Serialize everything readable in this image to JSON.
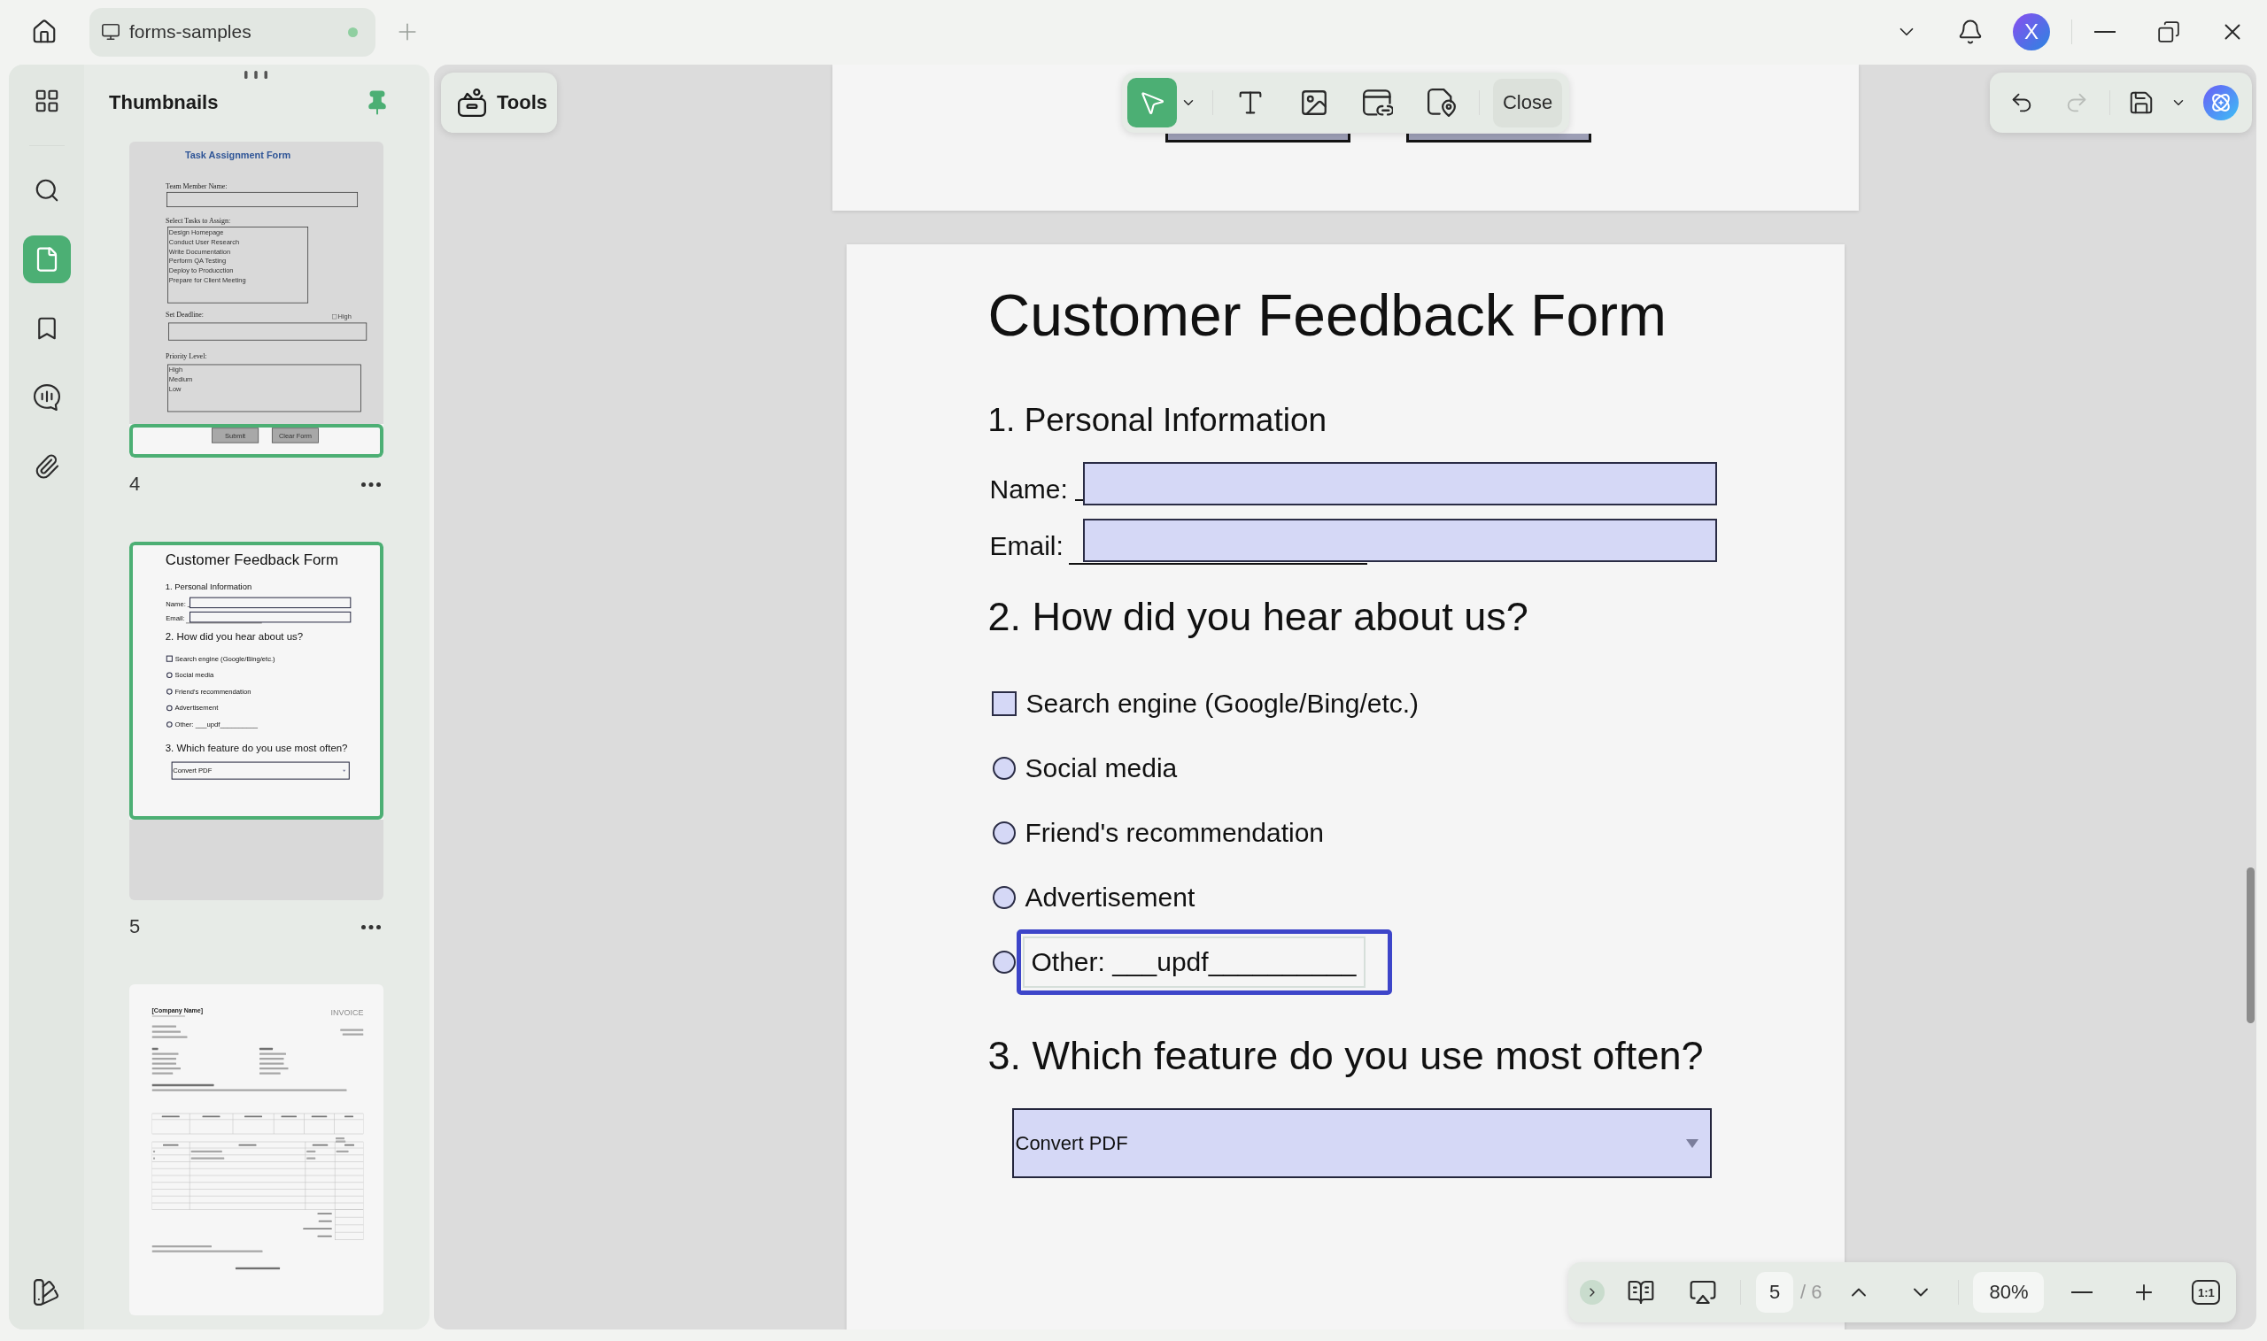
{
  "title_bar": {
    "tab": {
      "title": "forms-samples",
      "modified": true
    },
    "avatar": "X"
  },
  "nav_rail": {
    "items": [
      {
        "kind": "apps",
        "selected": false
      },
      {
        "kind": "search",
        "selected": false
      },
      {
        "kind": "pages",
        "selected": true
      },
      {
        "kind": "bookmarks",
        "selected": false
      },
      {
        "kind": "comments",
        "selected": false
      },
      {
        "kind": "attachments",
        "selected": false
      }
    ]
  },
  "thumbnails_panel": {
    "title": "Thumbnails",
    "pinned": true,
    "pages": [
      {
        "kind": "task_form",
        "label": "4",
        "in_view": true,
        "content": {
          "title": "Task Assignment Form",
          "fields": [
            {
              "kind": "text",
              "label": "Team Member Name:"
            },
            {
              "kind": "list",
              "label": "Select Tasks to Assign:",
              "items": [
                "Design Homepage",
                "Conduct User Research",
                "Write Documentation",
                "Perform QA Testing",
                "Deploy to Producction",
                "Prepare for Client Meeting"
              ]
            },
            {
              "kind": "text",
              "label": "Set Deadline:",
              "checkbox": {
                "label": "High",
                "checked": false
              }
            },
            {
              "kind": "list",
              "label": "Priority Level:",
              "items": [
                "High",
                "Medium",
                "Low"
              ]
            }
          ],
          "buttons": [
            "Submit",
            "Clear Form"
          ]
        }
      },
      {
        "kind": "feedback_form",
        "label": "5",
        "in_view": true,
        "content": {
          "title": "Customer Feedback Form",
          "personal_heading": "1. Personal Information",
          "fields": [
            {
              "kind": "covered",
              "label": "Name:"
            },
            {
              "kind": "underlined",
              "label": "Email:"
            }
          ],
          "source_heading": "2. How did you hear about us?",
          "options": [
            {
              "kind": "checkbox",
              "label": "Search engine (Google/Bing/etc.)",
              "checked": false
            },
            {
              "kind": "radio",
              "label": "Social media",
              "selected": false
            },
            {
              "kind": "radio",
              "label": "Friend's recommendation",
              "selected": false
            },
            {
              "kind": "radio",
              "label": "Advertisement",
              "selected": false
            },
            {
              "kind": "radio",
              "label": "Other: ___updf__________",
              "selected": false
            }
          ],
          "feature_heading": "3. Which feature do you use most often?",
          "dropdown": {
            "value": "Convert PDF"
          }
        }
      },
      {
        "kind": "invoice",
        "in_view": false,
        "content": {
          "company": "[Company Name]",
          "heading": "INVOICE"
        }
      }
    ]
  },
  "tools_button": {
    "label": "Tools"
  },
  "edit_toolbar": {
    "tools": [
      {
        "kind": "select",
        "selected": true
      },
      {
        "kind": "text",
        "selected": false
      },
      {
        "kind": "image",
        "selected": false
      },
      {
        "kind": "link",
        "selected": false
      },
      {
        "kind": "location",
        "selected": false
      }
    ],
    "close": "Close"
  },
  "history_toolbar": {
    "undo": {
      "disabled": false
    },
    "redo": {
      "disabled": true
    }
  },
  "document": {
    "page": {
      "title": "Customer Feedback Form",
      "personal_heading": "1. Personal Information",
      "fields": [
        {
          "kind": "covered",
          "label": "Name:"
        },
        {
          "kind": "underlined",
          "label": "Email:"
        }
      ],
      "source_heading": "2. How did you hear about us?",
      "options": [
        {
          "kind": "checkbox",
          "label": "Search engine (Google/Bing/etc.)",
          "checked": false,
          "focused": false
        },
        {
          "kind": "radio",
          "label": "Social media",
          "selected": false,
          "focused": false
        },
        {
          "kind": "radio",
          "label": "Friend's recommendation",
          "selected": false,
          "focused": false
        },
        {
          "kind": "radio",
          "label": "Advertisement",
          "selected": false,
          "focused": false
        },
        {
          "kind": "radio",
          "label": "Other: ___updf__________",
          "selected": false,
          "focused": true
        }
      ],
      "feature_heading": "3. Which feature do you use most often?",
      "dropdown": {
        "value": "Convert PDF"
      }
    }
  },
  "page_bar": {
    "page": "5",
    "total": "/ 6",
    "zoom": "80%",
    "actual_size": "1:1"
  }
}
